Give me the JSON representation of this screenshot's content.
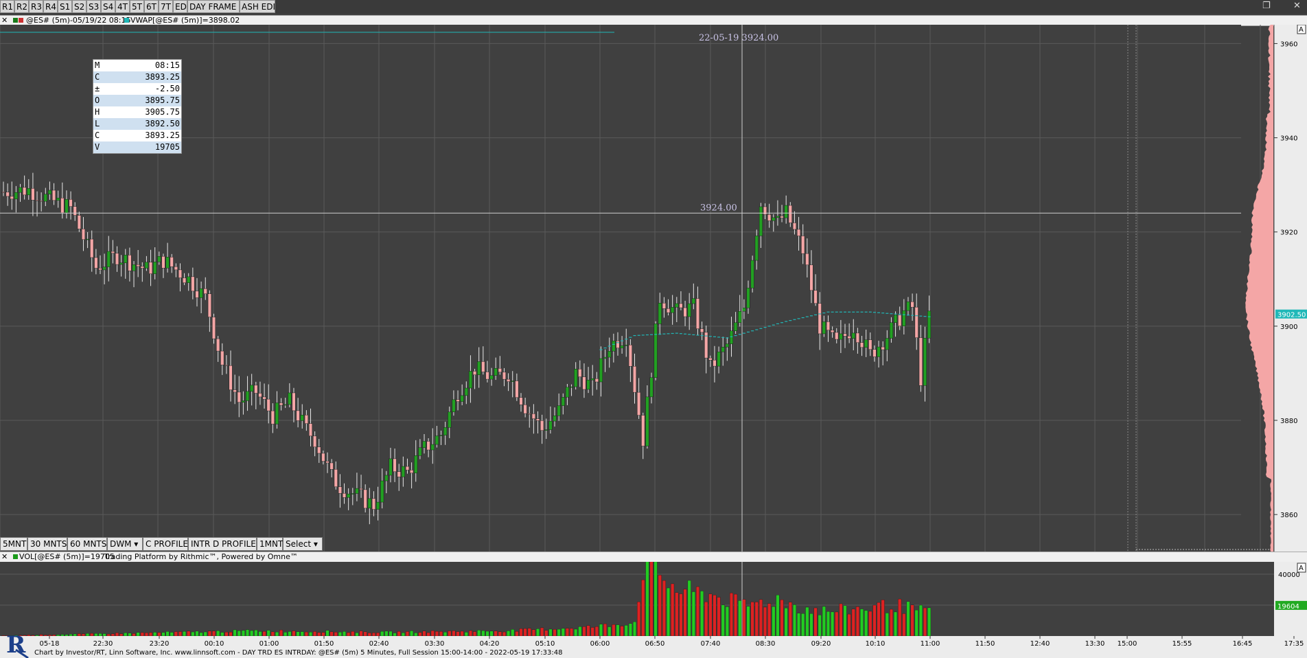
{
  "toolbar": {
    "tabs": [
      "R1",
      "R2",
      "R3",
      "R4",
      "S1",
      "S2",
      "S3",
      "S4",
      "4T",
      "5T",
      "6T",
      "7T",
      "EDI",
      "DAY FRAME",
      "ASH EDI"
    ]
  },
  "price_pane": {
    "header": "@ES# (5m)-05/19/22 08:15",
    "indicator": "VWAP[@ES# (5m)]=3898.02",
    "crosshair_label": "22-05-19  3924.00",
    "crosshair_price_label": "3924.00",
    "last_price_label": "3902.50",
    "corner_label": "A"
  },
  "ohlc_box": [
    {
      "k": "M",
      "v": "08:15"
    },
    {
      "k": "C",
      "v": "3893.25"
    },
    {
      "k": "±",
      "v": "-2.50"
    },
    {
      "k": "O",
      "v": "3895.75"
    },
    {
      "k": "H",
      "v": "3905.75"
    },
    {
      "k": "L",
      "v": "3892.50"
    },
    {
      "k": "C",
      "v": "3893.25"
    },
    {
      "k": "V",
      "v": "19705"
    }
  ],
  "bottom_buttons": [
    "5MNT",
    "30 MNTS",
    "60 MNTS",
    "DWM",
    "C PROFILE",
    "INTR D PROFILE",
    "1MNT",
    "Select"
  ],
  "volume_pane": {
    "header": "VOL[@ES# (5m)]=19705",
    "text": "Trading Platform by Rithmic™, Powered by Omne™",
    "last_volume_label": "19604",
    "corner_label": "A"
  },
  "footer": "Chart by Investor/RT, Linn Software, Inc. www.linnsoft.com - DAY TRD ES  INTRDAY: @ES# (5m) 5 Minutes, Full Session 15:00-14:00 - 2022-05-19 17:33:48",
  "colors": {
    "background": "#404040",
    "up_candle": "#22a022",
    "down_candle": "#f4a6a6",
    "vwap": "#20b8b8",
    "volume_up": "#22cc22",
    "volume_down": "#dd2222",
    "profile": "#f4a6a6"
  },
  "chart_data": [
    {
      "type": "candlestick",
      "title": "@ES# (5m)",
      "y_ticks": [
        3860,
        3880,
        3900,
        3920,
        3940,
        3960
      ],
      "ylim": [
        3852,
        3964
      ],
      "x_ticks": [
        "05-18",
        "22:30",
        "23:20",
        "00:10",
        "01:00",
        "01:50",
        "02:40",
        "03:30",
        "04:20",
        "05:10",
        "06:00",
        "06:50",
        "07:40",
        "08:30",
        "09:20",
        "10:10",
        "11:00",
        "11:50",
        "12:40",
        "13:30",
        "15:00",
        "15:55",
        "16:45",
        "17:35"
      ],
      "series_anchors_close": [
        [
          0,
          3928.5
        ],
        [
          6,
          3929
        ],
        [
          12,
          3926.5
        ],
        [
          16,
          3925
        ],
        [
          22,
          3912.5
        ],
        [
          27,
          3915
        ],
        [
          34,
          3912
        ],
        [
          38,
          3914
        ],
        [
          44,
          3910
        ],
        [
          48,
          3906
        ],
        [
          52,
          3892
        ],
        [
          56,
          3884
        ],
        [
          60,
          3886
        ],
        [
          64,
          3881
        ],
        [
          68,
          3884
        ],
        [
          72,
          3878
        ],
        [
          74,
          3876
        ],
        [
          78,
          3868
        ],
        [
          80,
          3866
        ],
        [
          84,
          3864
        ],
        [
          88,
          3862
        ],
        [
          92,
          3870
        ],
        [
          96,
          3869
        ],
        [
          100,
          3874
        ],
        [
          104,
          3877
        ],
        [
          108,
          3886
        ],
        [
          112,
          3891
        ],
        [
          116,
          3889
        ],
        [
          120,
          3890
        ],
        [
          124,
          3883
        ],
        [
          128,
          3878
        ],
        [
          132,
          3882
        ],
        [
          136,
          3890
        ],
        [
          140,
          3887
        ],
        [
          144,
          3896
        ],
        [
          148,
          3898
        ],
        [
          152,
          3876
        ],
        [
          156,
          3906
        ],
        [
          160,
          3903
        ],
        [
          164,
          3904
        ],
        [
          168,
          3891
        ],
        [
          172,
          3896
        ],
        [
          176,
          3904
        ],
        [
          180,
          3926
        ],
        [
          184,
          3922
        ],
        [
          186,
          3924
        ],
        [
          190,
          3916
        ],
        [
          194,
          3900
        ],
        [
          198,
          3896
        ],
        [
          202,
          3900
        ],
        [
          206,
          3894
        ],
        [
          210,
          3898
        ],
        [
          214,
          3903
        ],
        [
          216,
          3904
        ],
        [
          218,
          3889
        ],
        [
          220,
          3902.5
        ]
      ],
      "vwap": [
        [
          142,
          3895
        ],
        [
          150,
          3898
        ],
        [
          160,
          3898.5
        ],
        [
          172,
          3897.5
        ],
        [
          186,
          3901
        ],
        [
          196,
          3903
        ],
        [
          206,
          3903
        ],
        [
          220,
          3902
        ]
      ]
    },
    {
      "type": "bar",
      "title": "VOL[@ES# (5m)]",
      "y_ticks": [
        20000,
        40000
      ],
      "ylim": [
        0,
        48000
      ],
      "volume_anchors": [
        [
          0,
          300
        ],
        [
          60,
          3500
        ],
        [
          90,
          2500
        ],
        [
          120,
          3500
        ],
        [
          140,
          6000
        ],
        [
          150,
          9000
        ],
        [
          152,
          45000
        ],
        [
          156,
          40000
        ],
        [
          160,
          30000
        ],
        [
          168,
          27000
        ],
        [
          176,
          20000
        ],
        [
          184,
          24000
        ],
        [
          190,
          18000
        ],
        [
          196,
          16000
        ],
        [
          204,
          18000
        ],
        [
          212,
          20000
        ],
        [
          220,
          15000
        ]
      ]
    }
  ]
}
